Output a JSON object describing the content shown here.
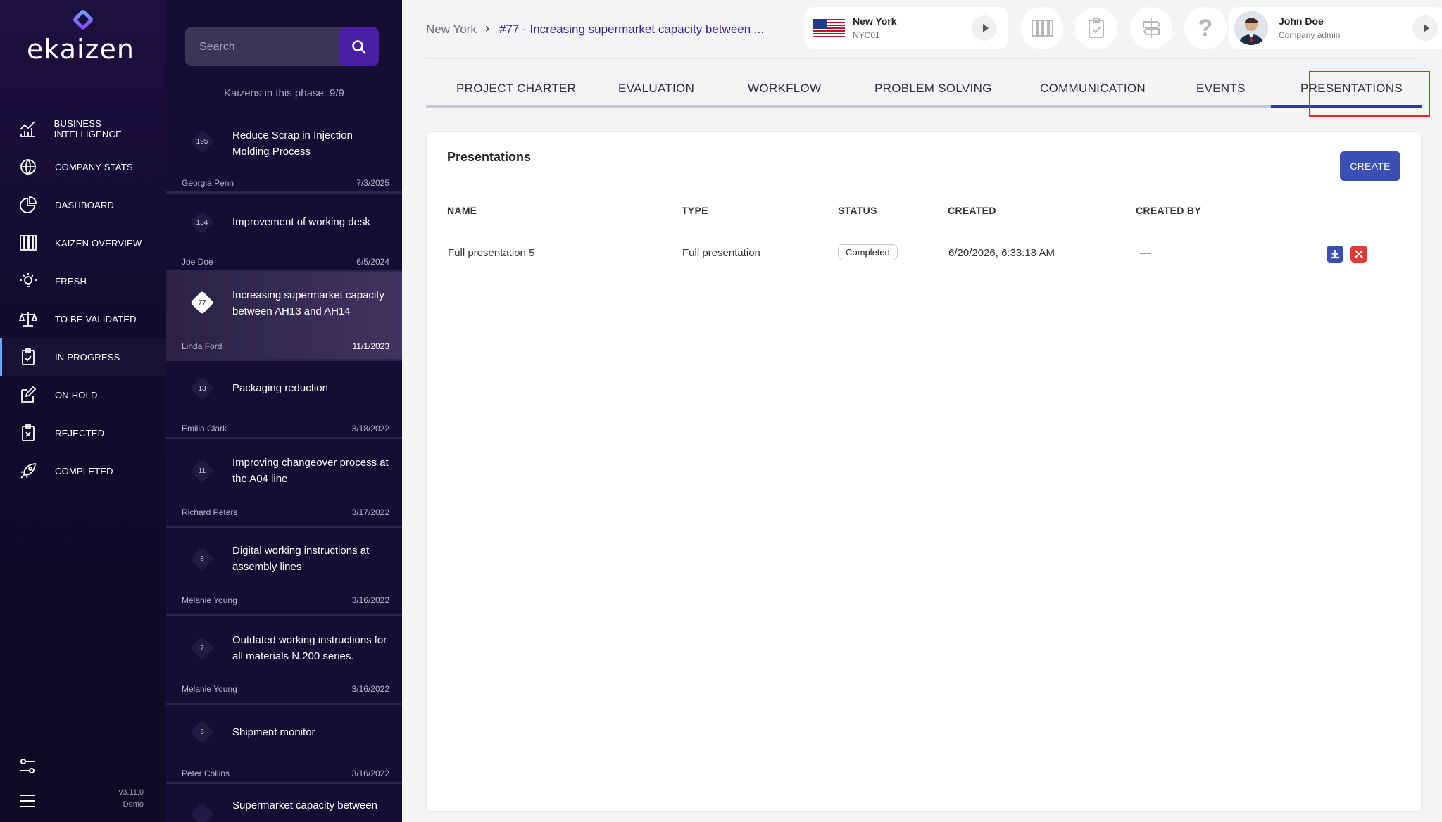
{
  "app": {
    "logo_text": "ekaizen",
    "version": "v3.11.0",
    "env": "Demo"
  },
  "nav": {
    "items": [
      {
        "label": "BUSINESS INTELLIGENCE",
        "icon": "chart-icon"
      },
      {
        "label": "COMPANY STATS",
        "icon": "globe-icon"
      },
      {
        "label": "DASHBOARD",
        "icon": "pie-chart-icon"
      },
      {
        "label": "KAIZEN OVERVIEW",
        "icon": "columns-icon"
      },
      {
        "label": "FRESH",
        "icon": "lightbulb-icon"
      },
      {
        "label": "TO BE VALIDATED",
        "icon": "scales-icon"
      },
      {
        "label": "IN PROGRESS",
        "icon": "clipboard-check-icon",
        "active": true
      },
      {
        "label": "ON HOLD",
        "icon": "edit-icon"
      },
      {
        "label": "REJECTED",
        "icon": "clipboard-x-icon"
      },
      {
        "label": "COMPLETED",
        "icon": "rocket-icon"
      }
    ]
  },
  "kaizen_list": {
    "search_placeholder": "Search",
    "phase_count": "Kaizens in this phase: 9/9",
    "items": [
      {
        "num": "195",
        "title": "Reduce Scrap in Injection Molding Process",
        "author": "Georgia Penn",
        "date": "7/3/2025"
      },
      {
        "num": "134",
        "title": "Improvement of working desk",
        "author": "Joe Doe",
        "date": "6/5/2024"
      },
      {
        "num": "77",
        "title": "Increasing supermarket capacity between AH13 and AH14",
        "author": "Linda Ford",
        "date": "11/1/2023",
        "selected": true
      },
      {
        "num": "13",
        "title": "Packaging reduction",
        "author": "Emilia Clark",
        "date": "3/18/2022"
      },
      {
        "num": "11",
        "title": "Improving changeover process at the A04 line",
        "author": "Richard Peters",
        "date": "3/17/2022"
      },
      {
        "num": "8",
        "title": "Digital working instructions at assembly lines",
        "author": "Melanie Young",
        "date": "3/16/2022"
      },
      {
        "num": "7",
        "title": "Outdated working instructions for all materials N.200 series.",
        "author": "Melanie Young",
        "date": "3/16/2022"
      },
      {
        "num": "5",
        "title": "Shipment monitor",
        "author": "Peter Collins",
        "date": "3/16/2022"
      },
      {
        "num": "",
        "title": "Supermarket capacity between",
        "author": "",
        "date": ""
      }
    ]
  },
  "header": {
    "breadcrumb_root": "New York",
    "breadcrumb_sep": "›",
    "breadcrumb_current": "#77 - Increasing supermarket capacity between ...",
    "location": {
      "name": "New York",
      "code": "NYC01"
    },
    "help": "?",
    "user": {
      "name": "John Doe",
      "role": "Company admin"
    }
  },
  "tabs": [
    "PROJECT CHARTER",
    "EVALUATION",
    "WORKFLOW",
    "PROBLEM SOLVING",
    "COMMUNICATION",
    "EVENTS",
    "PRESENTATIONS"
  ],
  "active_tab": "PRESENTATIONS",
  "presentations": {
    "title": "Presentations",
    "create_label": "CREATE",
    "columns": [
      "NAME",
      "TYPE",
      "STATUS",
      "CREATED",
      "CREATED BY"
    ],
    "rows": [
      {
        "name": "Full presentation 5",
        "type": "Full presentation",
        "status": "Completed",
        "created": "6/20/2026, 6:33:18 AM",
        "created_by": "—"
      }
    ]
  },
  "colors": {
    "accent": "#3a4fb4",
    "nav_bg": "#120b2e",
    "highlight": "#e02b2b",
    "danger": "#e53935"
  }
}
